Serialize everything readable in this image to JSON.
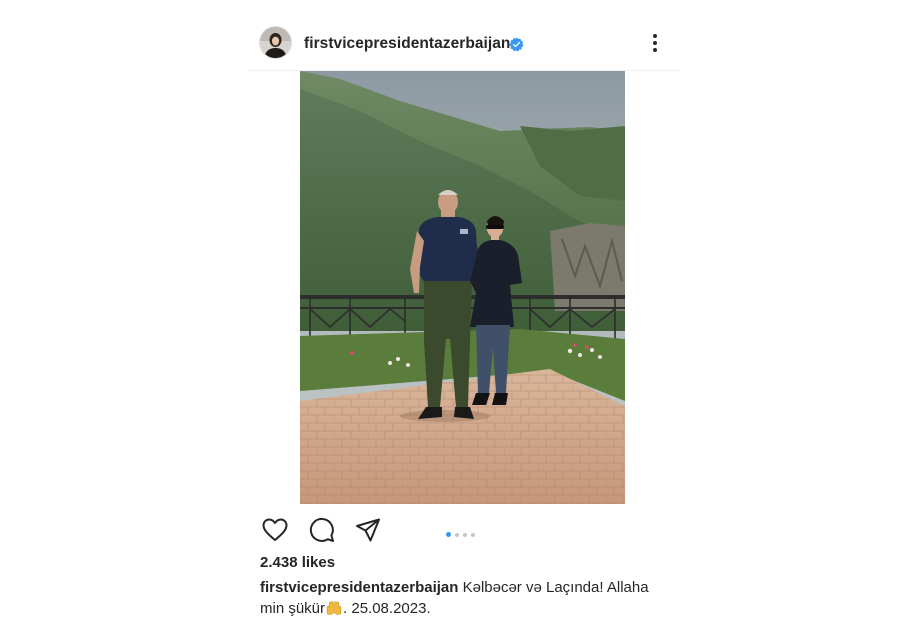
{
  "post": {
    "username": "firstvicepresidentazerbaijan",
    "verified_icon": "verified-badge-icon",
    "more_icon": "more-options-icon",
    "likes": "2.438 likes",
    "carousel": {
      "current_slide": 1,
      "total_slides": 4
    },
    "caption": {
      "username": "firstvicepresidentazerbaijan",
      "text_before_emoji": "Kəlbəcər və Laçında! Allaha min şükür",
      "emoji_icon": "raising-hands-emoji-icon",
      "text_after_emoji": ". 25.08.2023."
    }
  },
  "actions": {
    "like_icon": "heart-icon",
    "comment_icon": "comment-icon",
    "share_icon": "paper-plane-icon"
  },
  "colors": {
    "accent_blue": "#3897f0",
    "text": "#262626",
    "divider": "#efefef"
  }
}
